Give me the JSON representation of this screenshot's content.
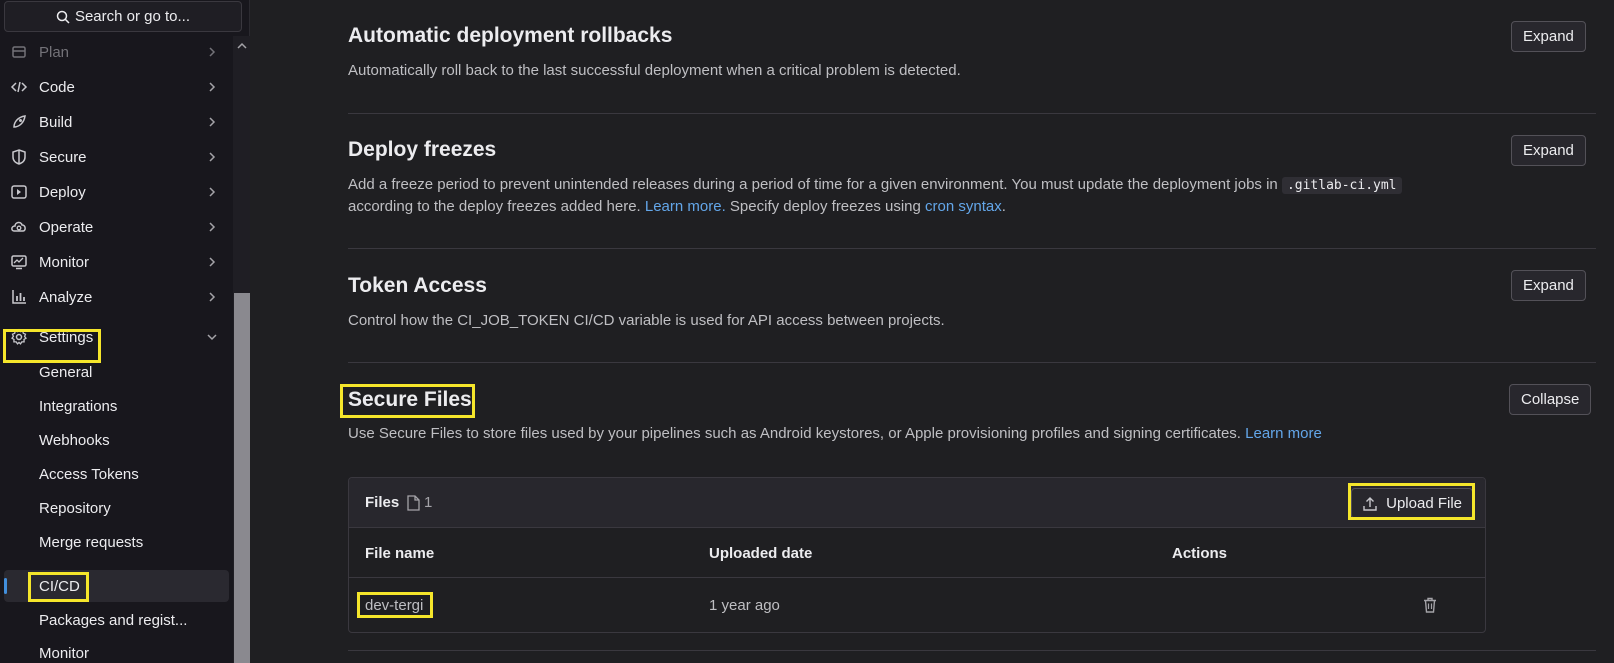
{
  "search": {
    "label": "Search or go to..."
  },
  "sidebar": {
    "items": [
      {
        "label": "Plan",
        "icon": "plan-icon"
      },
      {
        "label": "Code",
        "icon": "code-icon"
      },
      {
        "label": "Build",
        "icon": "rocket-icon"
      },
      {
        "label": "Secure",
        "icon": "shield-icon"
      },
      {
        "label": "Deploy",
        "icon": "deploy-icon"
      },
      {
        "label": "Operate",
        "icon": "cloud-gear-icon"
      },
      {
        "label": "Monitor",
        "icon": "monitor-icon"
      },
      {
        "label": "Analyze",
        "icon": "chart-icon"
      },
      {
        "label": "Settings",
        "icon": "gear-icon"
      }
    ],
    "settings_sub": [
      {
        "label": "General"
      },
      {
        "label": "Integrations"
      },
      {
        "label": "Webhooks"
      },
      {
        "label": "Access Tokens"
      },
      {
        "label": "Repository"
      },
      {
        "label": "Merge requests"
      },
      {
        "label": "CI/CD"
      },
      {
        "label": "Packages and regist..."
      },
      {
        "label": "Monitor"
      }
    ],
    "active_item": "CI/CD"
  },
  "sections": {
    "rollbacks": {
      "title": "Automatic deployment rollbacks",
      "desc": "Automatically roll back to the last successful deployment when a critical problem is detected.",
      "button": "Expand"
    },
    "freezes": {
      "title": "Deploy freezes",
      "desc_1": "Add a freeze period to prevent unintended releases during a period of time for a given environment. You must update the deployment jobs in",
      "code": ".gitlab-ci.yml",
      "desc_2": "according to the deploy freezes added here.",
      "learn_more": "Learn more.",
      "desc_3": "Specify deploy freezes using",
      "cron_link": "cron syntax",
      "desc_4": ".",
      "button": "Expand"
    },
    "token": {
      "title": "Token Access",
      "desc": "Control how the CI_JOB_TOKEN CI/CD variable is used for API access between projects.",
      "button": "Expand"
    },
    "secure_files": {
      "title": "Secure Files",
      "desc": "Use Secure Files to store files used by your pipelines such as Android keystores, or Apple provisioning profiles and signing certificates.",
      "learn_more": "Learn more",
      "button": "Collapse",
      "card": {
        "title": "Files",
        "count": "1",
        "upload_label": "Upload File",
        "columns": [
          "File name",
          "Uploaded date",
          "Actions"
        ],
        "rows": [
          {
            "name": "dev-tergi",
            "date": "1 year ago"
          }
        ]
      }
    }
  },
  "colors": {
    "highlight": "#f5e62b",
    "link": "#63a6e9",
    "active_bar": "#428fdc"
  }
}
